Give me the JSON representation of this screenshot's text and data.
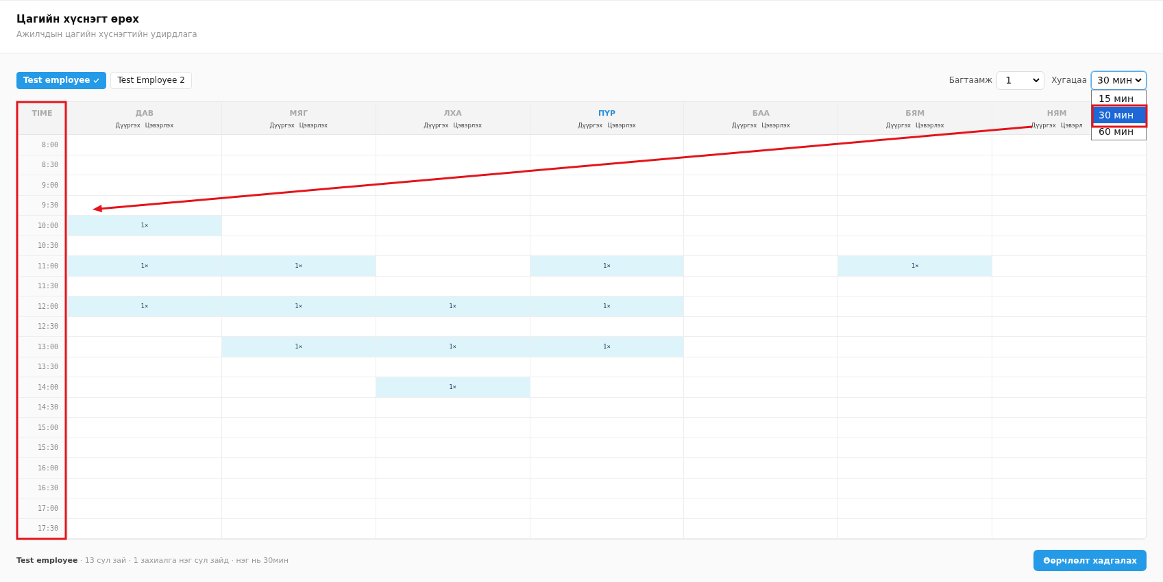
{
  "header": {
    "title": "Цагийн хүснэгт өрөх",
    "subtitle": "Ажилчдын цагийн хүснэгтийн удирдлага"
  },
  "employees": [
    {
      "label": "Test employee",
      "selected": true
    },
    {
      "label": "Test Employee 2",
      "selected": false
    }
  ],
  "controls": {
    "capacity_label": "Багтаамж",
    "capacity_value": "1",
    "duration_label": "Хугацаа",
    "duration_value": "30 мин",
    "duration_options": [
      {
        "label": "15 мин",
        "selected": false
      },
      {
        "label": "30 мин",
        "selected": true
      },
      {
        "label": "60 мин",
        "selected": false
      }
    ]
  },
  "table": {
    "time_header": "TIME",
    "days": [
      {
        "name": "ДАВ",
        "today": false,
        "actions": [
          "Дүүргэх",
          "Цэвэрлэх"
        ]
      },
      {
        "name": "МЯГ",
        "today": false,
        "actions": [
          "Дүүргэх",
          "Цэвэрлэх"
        ]
      },
      {
        "name": "ЛХА",
        "today": false,
        "actions": [
          "Дүүргэх",
          "Цэвэрлэх"
        ]
      },
      {
        "name": "ПҮР",
        "today": true,
        "actions": [
          "Дүүргэх",
          "Цэвэрлэх"
        ]
      },
      {
        "name": "БАА",
        "today": false,
        "actions": [
          "Дүүргэх",
          "Цэвэрлэх"
        ]
      },
      {
        "name": "БЯМ",
        "today": false,
        "actions": [
          "Дүүргэх",
          "Цэвэрлэх"
        ]
      },
      {
        "name": "НЯМ",
        "today": false,
        "actions": [
          "Дүүргэх",
          "Цэвэрл"
        ]
      }
    ],
    "rows": [
      {
        "time": "8:00",
        "cells": [
          null,
          null,
          null,
          null,
          null,
          null,
          null
        ]
      },
      {
        "time": "8:30",
        "cells": [
          null,
          null,
          null,
          null,
          null,
          null,
          null
        ]
      },
      {
        "time": "9:00",
        "cells": [
          null,
          null,
          null,
          null,
          null,
          null,
          null
        ]
      },
      {
        "time": "9:30",
        "cells": [
          null,
          null,
          null,
          null,
          null,
          null,
          null
        ]
      },
      {
        "time": "10:00",
        "cells": [
          {
            "text": "1×"
          },
          null,
          null,
          null,
          null,
          null,
          null
        ]
      },
      {
        "time": "10:30",
        "cells": [
          null,
          null,
          null,
          null,
          null,
          null,
          null
        ]
      },
      {
        "time": "11:00",
        "cells": [
          {
            "text": "1×"
          },
          {
            "text": "1×"
          },
          null,
          {
            "text": "1×"
          },
          null,
          {
            "text": "1×"
          },
          null
        ]
      },
      {
        "time": "11:30",
        "cells": [
          null,
          null,
          null,
          null,
          null,
          null,
          null
        ]
      },
      {
        "time": "12:00",
        "cells": [
          {
            "text": "1×"
          },
          {
            "text": "1×"
          },
          {
            "text": "1×"
          },
          {
            "text": "1×"
          },
          null,
          null,
          null
        ]
      },
      {
        "time": "12:30",
        "cells": [
          null,
          null,
          null,
          null,
          null,
          null,
          null
        ]
      },
      {
        "time": "13:00",
        "cells": [
          null,
          {
            "text": "1×"
          },
          {
            "text": "1×"
          },
          {
            "text": "1×"
          },
          null,
          null,
          null
        ]
      },
      {
        "time": "13:30",
        "cells": [
          null,
          null,
          null,
          null,
          null,
          null,
          null
        ]
      },
      {
        "time": "14:00",
        "cells": [
          null,
          null,
          {
            "text": "1×"
          },
          null,
          null,
          null,
          null
        ]
      },
      {
        "time": "14:30",
        "cells": [
          null,
          null,
          null,
          null,
          null,
          null,
          null
        ]
      },
      {
        "time": "15:00",
        "cells": [
          null,
          null,
          null,
          null,
          null,
          null,
          null
        ]
      },
      {
        "time": "15:30",
        "cells": [
          null,
          null,
          null,
          null,
          null,
          null,
          null
        ]
      },
      {
        "time": "16:00",
        "cells": [
          null,
          null,
          null,
          null,
          null,
          null,
          null
        ]
      },
      {
        "time": "16:30",
        "cells": [
          null,
          null,
          null,
          null,
          null,
          null,
          null
        ]
      },
      {
        "time": "17:00",
        "cells": [
          null,
          null,
          null,
          null,
          null,
          null,
          null
        ]
      },
      {
        "time": "17:30",
        "cells": [
          null,
          null,
          null,
          null,
          null,
          null,
          null
        ]
      }
    ]
  },
  "footer": {
    "summary": "**Test employee** · 13 сул зай · 1 захиалга нэг сул зайд · нэг нь 30мин",
    "save_button": "Өөрчлөлт хадгалах"
  },
  "annotations": [
    {
      "kind": "box"
    },
    {
      "kind": "box"
    },
    {
      "kind": "arrow"
    }
  ]
}
